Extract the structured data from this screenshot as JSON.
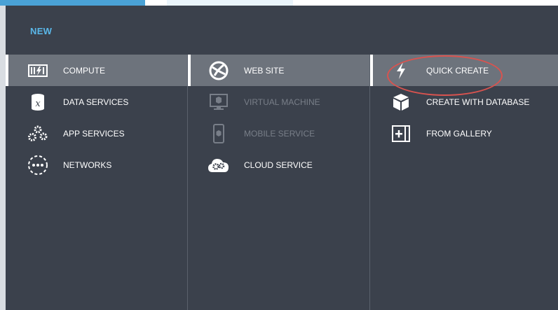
{
  "header": {
    "new_label": "NEW"
  },
  "categories": [
    {
      "label": "COMPUTE",
      "icon": "compute-icon",
      "selected": true
    },
    {
      "label": "DATA SERVICES",
      "icon": "data-services-icon"
    },
    {
      "label": "APP SERVICES",
      "icon": "app-services-icon"
    },
    {
      "label": "NETWORKS",
      "icon": "networks-icon"
    }
  ],
  "compute_items": [
    {
      "label": "WEB SITE",
      "icon": "globe-icon",
      "selected": true
    },
    {
      "label": "VIRTUAL MACHINE",
      "icon": "monitor-icon",
      "disabled": true
    },
    {
      "label": "MOBILE SERVICE",
      "icon": "phone-icon",
      "disabled": true
    },
    {
      "label": "CLOUD SERVICE",
      "icon": "cloud-gear-icon"
    }
  ],
  "create_options": [
    {
      "label": "QUICK CREATE",
      "icon": "lightning-icon",
      "selected": true
    },
    {
      "label": "CREATE WITH DATABASE",
      "icon": "cube-icon"
    },
    {
      "label": "FROM GALLERY",
      "icon": "gallery-icon"
    }
  ],
  "colors": {
    "background": "#3b414c",
    "selected_row": "#6d737c",
    "accent_blue": "#5ab7e8",
    "annotation_red": "#d9534f"
  }
}
